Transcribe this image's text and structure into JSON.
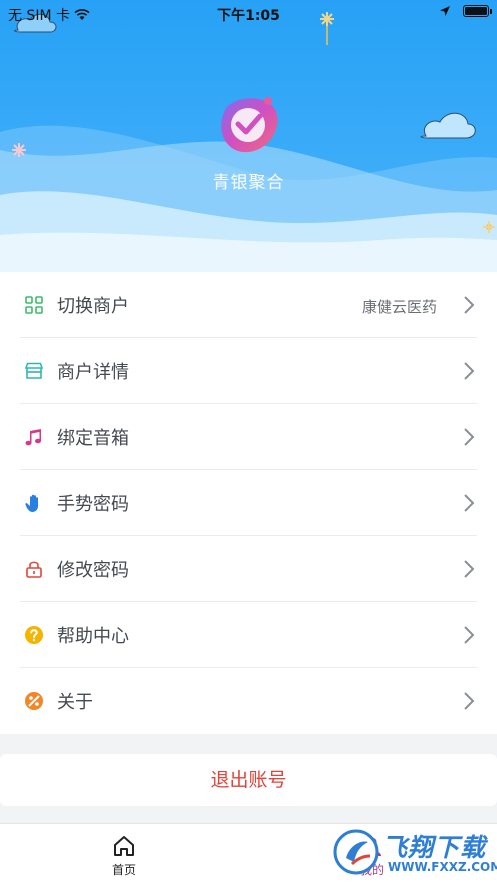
{
  "status_bar": {
    "carrier": "无 SIM 卡",
    "time": "下午1:05"
  },
  "header": {
    "app_name": "青银聚合"
  },
  "menu": {
    "items": [
      {
        "label": "切换商户",
        "value": "康健云医药",
        "icon": "grid-icon",
        "color": "#3dbb6a"
      },
      {
        "label": "商户详情",
        "icon": "store-icon",
        "color": "#2fb8b0"
      },
      {
        "label": "绑定音箱",
        "icon": "music-note-icon",
        "color": "#d6398a"
      },
      {
        "label": "手势密码",
        "icon": "hand-icon",
        "color": "#2a7fe0"
      },
      {
        "label": "修改密码",
        "icon": "lock-icon",
        "color": "#e0443b"
      },
      {
        "label": "帮助中心",
        "icon": "question-icon",
        "color": "#f5b400"
      },
      {
        "label": "关于",
        "icon": "about-icon",
        "color": "#f0872a"
      }
    ]
  },
  "logout_label": "退出账号",
  "tabbar": {
    "tabs": [
      {
        "label": "首页",
        "icon": "home-icon"
      },
      {
        "label": "我的",
        "icon": "user-icon",
        "active": true
      }
    ]
  },
  "watermark": {
    "text": "飞翔下载",
    "url": "WWW.FXXZ.COM"
  },
  "colors": {
    "header_blue": "#27a1f6",
    "logout_red": "#e0443b",
    "text": "#444a52"
  }
}
